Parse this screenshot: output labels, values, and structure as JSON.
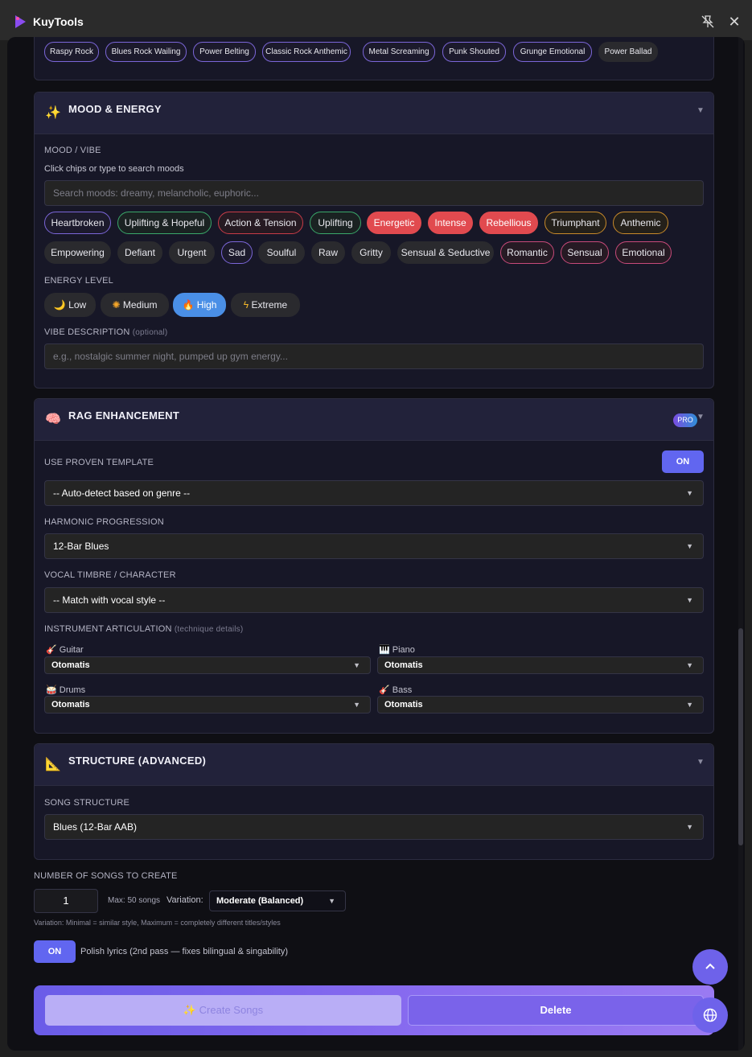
{
  "app": {
    "title": "KuyTools"
  },
  "vocal_styles": [
    "Raspy Rock",
    "Blues Rock Wailing",
    "Power Belting",
    "Classic Rock Anthemic",
    "Metal Screaming",
    "Punk Shouted",
    "Grunge Emotional",
    "Power Ballad"
  ],
  "mood_section": {
    "title": "MOOD & ENERGY",
    "mood_label": "MOOD / VIBE",
    "hint": "Click chips or type to search moods",
    "search_placeholder": "Search moods: dreamy, melancholic, euphoric...",
    "moods_row1": [
      "Heartbroken",
      "Uplifting & Hopeful",
      "Action & Tension",
      "Uplifting",
      "Energetic",
      "Intense",
      "Rebellious",
      "Triumphant",
      "Anthemic"
    ],
    "moods_row2": [
      "Empowering",
      "Defiant",
      "Urgent",
      "Sad",
      "Soulful",
      "Raw",
      "Gritty",
      "Sensual & Seductive",
      "Romantic",
      "Sensual",
      "Emotional"
    ],
    "energy_label": "ENERGY LEVEL",
    "energy": [
      "Low",
      "Medium",
      "High",
      "Extreme"
    ],
    "energy_selected": "High",
    "vibe_label": "VIBE DESCRIPTION",
    "vibe_optional": "(optional)",
    "vibe_placeholder": "e.g., nostalgic summer night, pumped up gym energy..."
  },
  "rag_section": {
    "title": "RAG ENHANCEMENT",
    "badge": "PRO",
    "template_label": "USE PROVEN TEMPLATE",
    "template_toggle": "ON",
    "template_value": "-- Auto-detect based on genre --",
    "harmonic_label": "HARMONIC PROGRESSION",
    "harmonic_value": "12-Bar Blues",
    "timbre_label": "VOCAL TIMBRE / CHARACTER",
    "timbre_value": "-- Match with vocal style --",
    "articulation_label": "INSTRUMENT ARTICULATION",
    "articulation_hint": "(technique details)",
    "instruments": [
      {
        "name": "Guitar",
        "value": "Otomatis"
      },
      {
        "name": "Piano",
        "value": "Otomatis"
      },
      {
        "name": "Drums",
        "value": "Otomatis"
      },
      {
        "name": "Bass",
        "value": "Otomatis"
      }
    ]
  },
  "structure_section": {
    "title": "STRUCTURE (ADVANCED)",
    "song_structure_label": "SONG STRUCTURE",
    "song_structure_value": "Blues (12-Bar AAB)"
  },
  "songs": {
    "label": "NUMBER OF SONGS TO CREATE",
    "count": "1",
    "max_text": "Max: 50 songs",
    "variation_label": "Variation:",
    "variation_value": "Moderate (Balanced)",
    "variation_hint": "Variation: Minimal = similar style, Maximum = completely different titles/styles",
    "polish_toggle": "ON",
    "polish_text": "Polish lyrics (2nd pass — fixes bilingual & singability)"
  },
  "actions": {
    "create": "Create Songs",
    "delete": "Delete"
  },
  "colors": {
    "accent": "#6166f0",
    "selected_mood": "#e14a4f",
    "selected_energy": "#4a8fe6"
  }
}
